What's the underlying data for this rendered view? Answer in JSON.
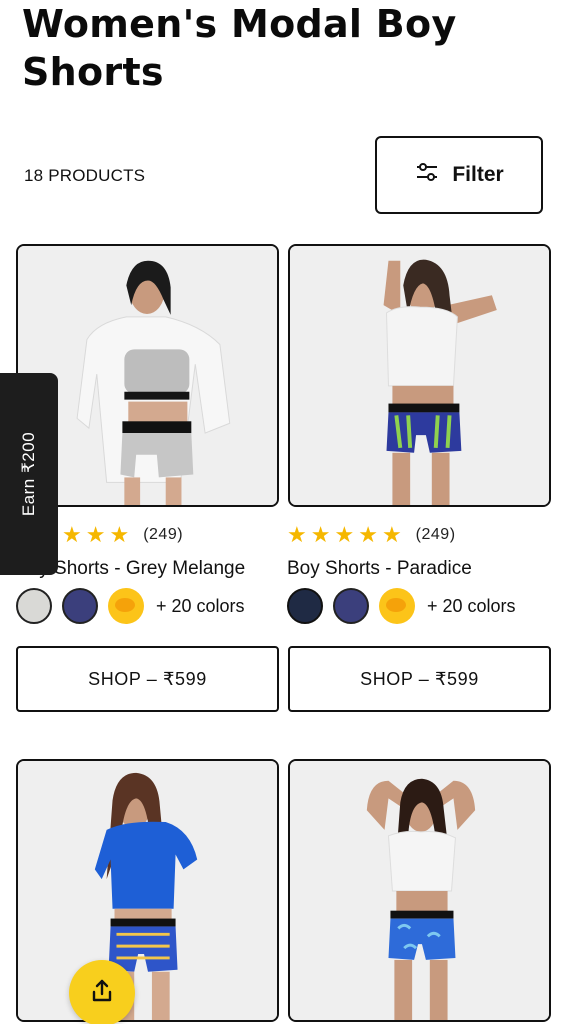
{
  "page": {
    "title": "Women's Modal Boy Shorts",
    "product_count": "18 PRODUCTS",
    "filter_label": "Filter"
  },
  "side_tab": {
    "label": "Earn ₹200"
  },
  "products": [
    {
      "rating_count": "(249)",
      "name": "Boy Shorts - Grey Melange",
      "swatches": [
        "#d9d9d6",
        "#3b3f7c",
        "emoji"
      ],
      "more_colors": "+ 20 colors",
      "shop_label": "SHOP – ₹599",
      "stars": 5
    },
    {
      "rating_count": "(249)",
      "name": "Boy Shorts - Paradice",
      "swatches": [
        "#1f2a44",
        "#3b3f7c",
        "emoji"
      ],
      "more_colors": "+ 20 colors",
      "shop_label": "SHOP – ₹599",
      "stars": 5
    }
  ],
  "colors": {
    "accent_yellow": "#f8cf1d",
    "star": "#f5b700",
    "dark_tab": "#1d1d1d"
  }
}
